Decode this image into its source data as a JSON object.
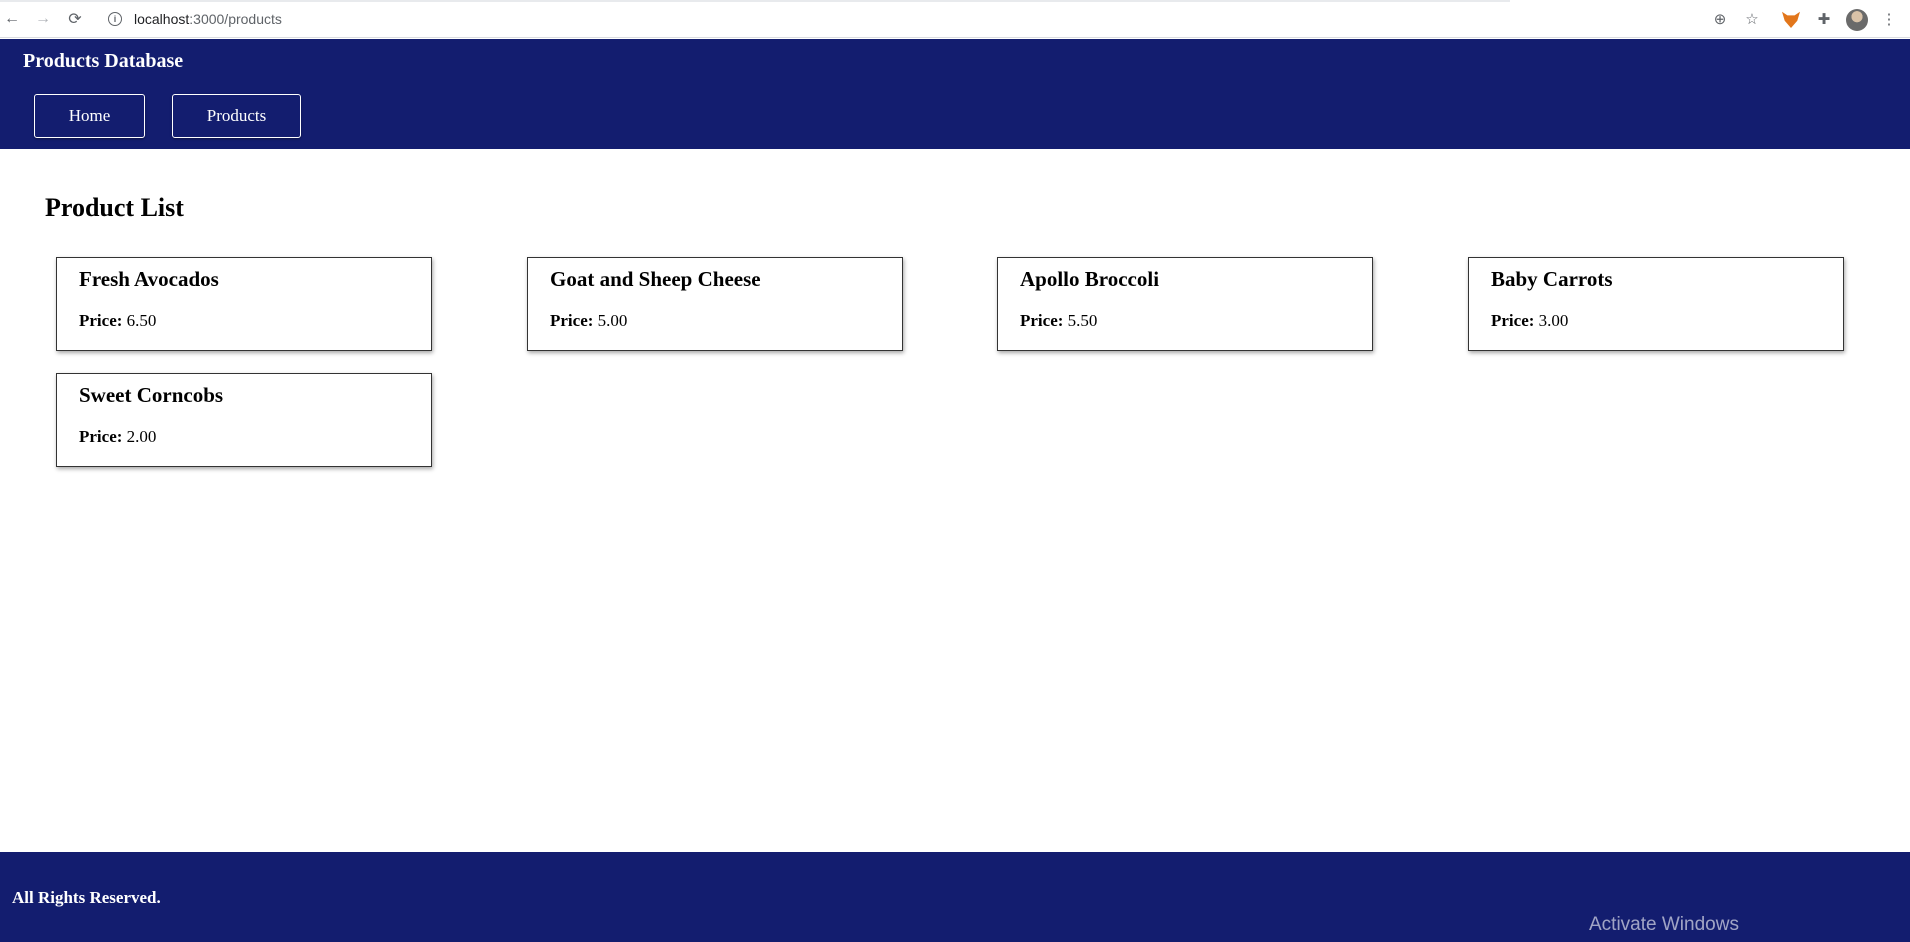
{
  "browser": {
    "url_host": "localhost",
    "url_path": ":3000/products",
    "back_glyph": "←",
    "forward_glyph": "→",
    "reload_glyph": "⟳",
    "info_glyph": "i",
    "zoom_glyph": "⊕",
    "star_glyph": "☆",
    "extensions_glyph": "✚",
    "menu_glyph": "⋮"
  },
  "header": {
    "title": "Products Database",
    "nav": [
      {
        "label": "Home"
      },
      {
        "label": "Products"
      }
    ]
  },
  "main": {
    "title": "Product List",
    "price_label": "Price:",
    "products": [
      {
        "name": "Fresh Avocados",
        "price": "6.50"
      },
      {
        "name": "Goat and Sheep Cheese",
        "price": "5.00"
      },
      {
        "name": "Apollo Broccoli",
        "price": "5.50"
      },
      {
        "name": "Baby Carrots",
        "price": "3.00"
      },
      {
        "name": "Sweet Corncobs",
        "price": "2.00"
      }
    ]
  },
  "footer": {
    "text": "All Rights Reserved.",
    "watermark": "Activate Windows"
  },
  "colors": {
    "header_bg": "#131d6f",
    "footer_bg": "#131d6f"
  }
}
